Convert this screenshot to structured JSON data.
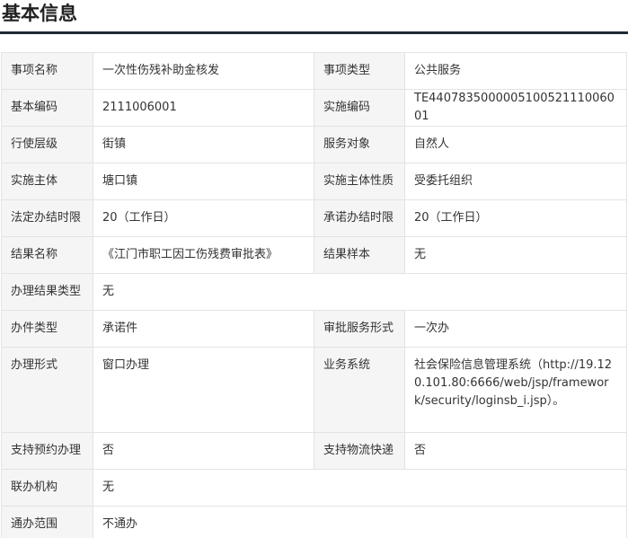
{
  "page_title": "基本信息",
  "rows": [
    {
      "l1": "事项名称",
      "v1": "一次性伤残补助金核发",
      "l2": "事项类型",
      "v2": "公共服务"
    },
    {
      "l1": "基本编码",
      "v1": "2111006001",
      "l2": "实施编码",
      "v2": "TE440783500000510052111006001"
    },
    {
      "l1": "行使层级",
      "v1": "街镇",
      "l2": "服务对象",
      "v2": "自然人"
    },
    {
      "l1": "实施主体",
      "v1": "塘口镇",
      "l2": "实施主体性质",
      "v2": "受委托组织"
    },
    {
      "l1": "法定办结时限",
      "v1": "20（工作日）",
      "l2": "承诺办结时限",
      "v2": "20（工作日）"
    },
    {
      "l1": "结果名称",
      "v1": "《江门市职工因工伤残费审批表》",
      "l2": "结果样本",
      "v2": "无"
    },
    {
      "l1": "办理结果类型",
      "v1": "无"
    },
    {
      "l1": "办件类型",
      "v1": "承诺件",
      "l2": "审批服务形式",
      "v2": "一次办"
    },
    {
      "l1": "办理形式",
      "v1": "窗口办理",
      "l2": "业务系统",
      "v2": "社会保险信息管理系统（http://19.120.101.80:6666/web/jsp/framework/security/loginsb_i.jsp）。"
    },
    {
      "l1": "支持预约办理",
      "v1": "否",
      "l2": "支持物流快递",
      "v2": "否"
    },
    {
      "l1": "联办机构",
      "v1": "无"
    },
    {
      "l1": "通办范围",
      "v1": "不通办"
    }
  ]
}
